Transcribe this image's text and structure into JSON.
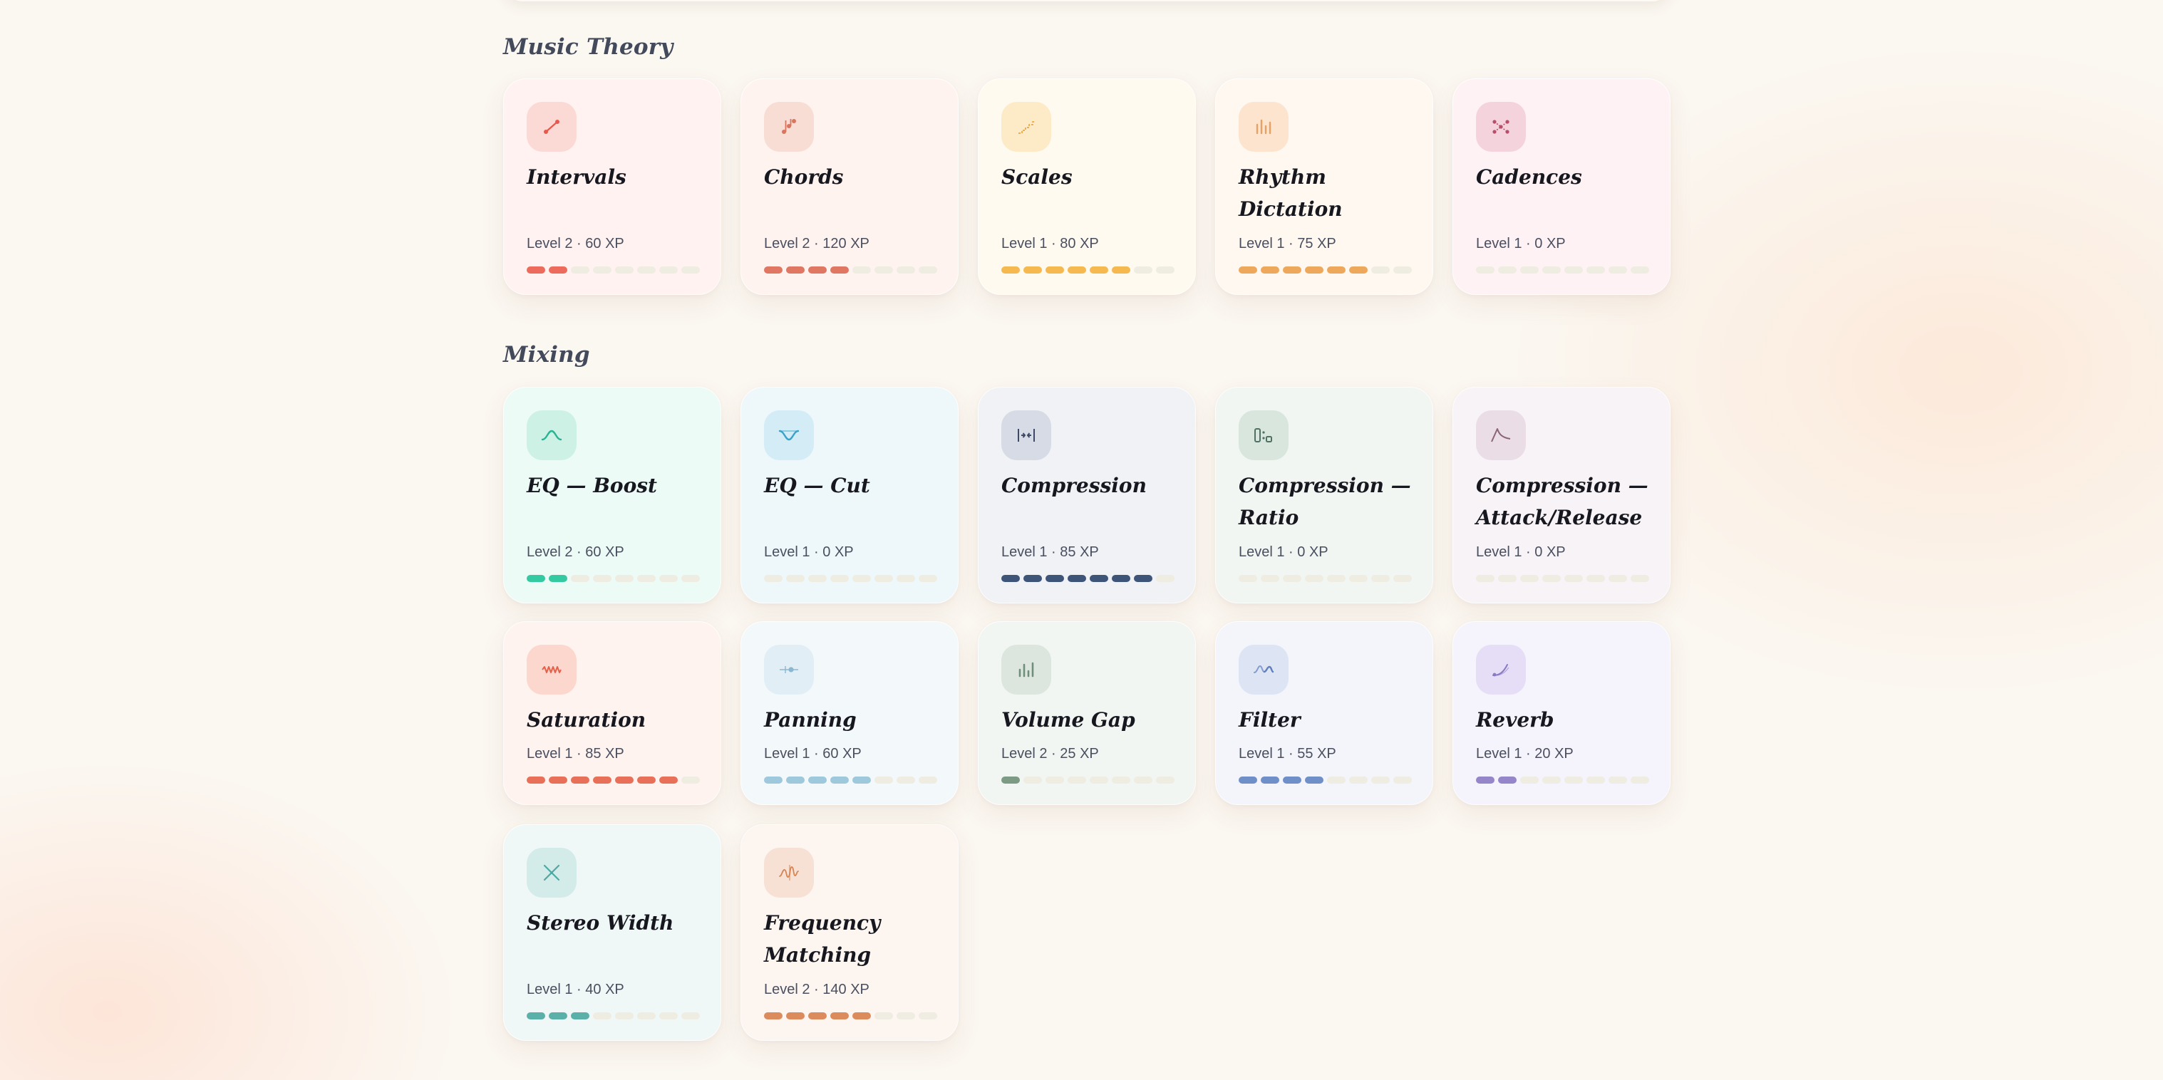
{
  "sections": [
    {
      "title": "Music Theory",
      "cards": [
        {
          "title": "Intervals",
          "meta": "Level 2 · 60 XP",
          "progress": 2,
          "icon": "intervals-icon",
          "icon_color": "#e8594d",
          "icon_bg": "#fbd9d5",
          "card_bg": "#fff2f0",
          "fill_color": "#ec6b5c"
        },
        {
          "title": "Chords",
          "meta": "Level 2 · 120 XP",
          "progress": 4,
          "icon": "chords-icon",
          "icon_color": "#d9745e",
          "icon_bg": "#f7ddd3",
          "card_bg": "#fff3f0",
          "fill_color": "#df7762"
        },
        {
          "title": "Scales",
          "meta": "Level 1 · 80 XP",
          "progress": 6,
          "icon": "scales-icon",
          "icon_color": "#efad4f",
          "icon_bg": "#fdebc8",
          "card_bg": "#fffaf0",
          "fill_color": "#f5b94f"
        },
        {
          "title": "Rhythm Dictation",
          "meta": "Level 1 · 75 XP",
          "progress": 6,
          "icon": "rhythm-icon",
          "icon_color": "#e8a063",
          "icon_bg": "#fce4cf",
          "card_bg": "#fff8f0",
          "fill_color": "#eea85b"
        },
        {
          "title": "Cadences",
          "meta": "Level 1 · 0 XP",
          "progress": 0,
          "icon": "cadences-icon",
          "icon_color": "#b94e6a",
          "icon_bg": "#f4d3dc",
          "card_bg": "#fff2f4",
          "fill_color": "#c35a74"
        }
      ]
    },
    {
      "title": "Mixing",
      "cards": [
        {
          "title": "EQ — Boost",
          "meta": "Level 2 · 60 XP",
          "progress": 2,
          "icon": "eq-boost-icon",
          "icon_color": "#2bb394",
          "icon_bg": "#cdf1e5",
          "card_bg": "#edfbf7",
          "fill_color": "#34c9a1"
        },
        {
          "title": "EQ — Cut",
          "meta": "Level 1 · 0 XP",
          "progress": 0,
          "icon": "eq-cut-icon",
          "icon_color": "#3aa3c9",
          "icon_bg": "#d3ecf6",
          "card_bg": "#eef8fb",
          "fill_color": "#4aa8cc"
        },
        {
          "title": "Compression",
          "meta": "Level 1 · 85 XP",
          "progress": 7,
          "icon": "compression-icon",
          "icon_color": "#3c4a66",
          "icon_bg": "#d6dbe5",
          "card_bg": "#f0f2f6",
          "fill_color": "#3e5478"
        },
        {
          "title": "Compression — Ratio",
          "meta": "Level 1 · 0 XP",
          "progress": 0,
          "icon": "compression-ratio-icon",
          "icon_color": "#4f7264",
          "icon_bg": "#d8e6de",
          "card_bg": "#f1f6f3",
          "fill_color": "#5b8070"
        },
        {
          "title": "Compression — Attack/Release",
          "meta": "Level 1 · 0 XP",
          "progress": 0,
          "icon": "attack-release-icon",
          "icon_color": "#8a6478",
          "icon_bg": "#ebdde5",
          "card_bg": "#f7f3f6",
          "fill_color": "#8a6478"
        },
        {
          "title": "Saturation",
          "meta": "Level 1 · 85 XP",
          "progress": 7,
          "icon": "saturation-icon",
          "icon_color": "#e5614b",
          "icon_bg": "#fbd7cd",
          "card_bg": "#fff3ef",
          "fill_color": "#e86f58"
        },
        {
          "title": "Panning",
          "meta": "Level 1 · 60 XP",
          "progress": 5,
          "icon": "panning-icon",
          "icon_color": "#8cb8cf",
          "icon_bg": "#e2eef5",
          "card_bg": "#f3f8fa",
          "fill_color": "#9ec8dc"
        },
        {
          "title": "Volume Gap",
          "meta": "Level 2 · 25 XP",
          "progress": 1,
          "icon": "volume-gap-icon",
          "icon_color": "#6f8f78",
          "icon_bg": "#dce6df",
          "card_bg": "#f2f6f2",
          "fill_color": "#7c9a84"
        },
        {
          "title": "Filter",
          "meta": "Level 1 · 55 XP",
          "progress": 4,
          "icon": "filter-icon",
          "icon_color": "#5f7fbd",
          "icon_bg": "#dde4f4",
          "card_bg": "#f3f5fa",
          "fill_color": "#6e8fc8"
        },
        {
          "title": "Reverb",
          "meta": "Level 1 · 20 XP",
          "progress": 2,
          "icon": "reverb-icon",
          "icon_color": "#8a79c4",
          "icon_bg": "#e5def6",
          "card_bg": "#f5f3fb",
          "fill_color": "#9585c9"
        },
        {
          "title": "Stereo Width",
          "meta": "Level 1 · 40 XP",
          "progress": 3,
          "icon": "stereo-width-icon",
          "icon_color": "#4ea9a3",
          "icon_bg": "#d3ece9",
          "card_bg": "#f0f8f7",
          "fill_color": "#5bb1aa"
        },
        {
          "title": "Frequency Matching",
          "meta": "Level 2 · 140 XP",
          "progress": 5,
          "icon": "frequency-matching-icon",
          "icon_color": "#d68452",
          "icon_bg": "#f6e1d4",
          "card_bg": "#fcf5f0",
          "fill_color": "#dc8c5c"
        }
      ]
    }
  ],
  "empty_segment_color": "#efece2"
}
